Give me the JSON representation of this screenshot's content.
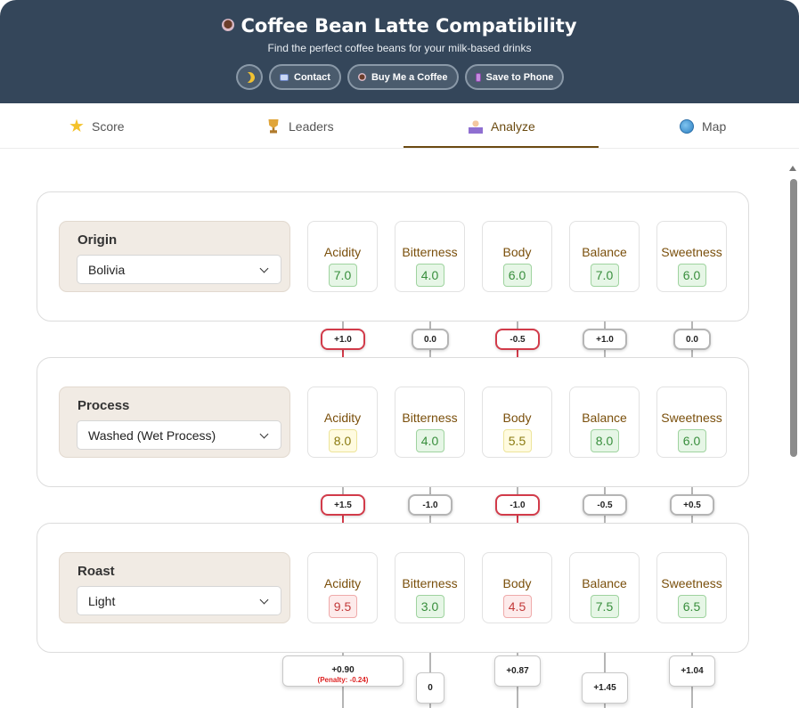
{
  "header": {
    "title": "Coffee Bean Latte Compatibility",
    "subtitle": "Find the perfect coffee beans for your milk-based drinks",
    "buttons": {
      "contact": "Contact",
      "buy": "Buy Me a Coffee",
      "save": "Save to Phone"
    },
    "icons": [
      "coffee-cup-icon",
      "moon-icon",
      "id-card-icon",
      "coffee-cup-icon",
      "phone-icon"
    ]
  },
  "tabs": [
    {
      "label": "Score",
      "icon": "star-icon",
      "active": false
    },
    {
      "label": "Leaders",
      "icon": "trophy-icon",
      "active": false
    },
    {
      "label": "Analyze",
      "icon": "scientist-icon",
      "active": true
    },
    {
      "label": "Map",
      "icon": "globe-icon",
      "active": false
    }
  ],
  "attributes": [
    "Acidity",
    "Bitterness",
    "Body",
    "Balance",
    "Sweetness"
  ],
  "sections": [
    {
      "label": "Origin",
      "selected": "Bolivia",
      "values": [
        "7.0",
        "4.0",
        "6.0",
        "7.0",
        "6.0"
      ],
      "levels": [
        "green",
        "green",
        "green",
        "green",
        "green"
      ]
    },
    {
      "label": "Process",
      "selected": "Washed (Wet Process)",
      "values": [
        "8.0",
        "4.0",
        "5.5",
        "8.0",
        "6.0"
      ],
      "levels": [
        "yellow",
        "green",
        "yellow",
        "green",
        "green"
      ]
    },
    {
      "label": "Roast",
      "selected": "Light",
      "values": [
        "9.5",
        "3.0",
        "4.5",
        "7.5",
        "6.5"
      ],
      "levels": [
        "red",
        "green",
        "red",
        "green",
        "green"
      ]
    }
  ],
  "deltas": [
    [
      "+1.0",
      "0.0",
      "-0.5",
      "+1.0",
      "0.0"
    ],
    [
      "+1.5",
      "-1.0",
      "-1.0",
      "-0.5",
      "+0.5"
    ]
  ],
  "results": {
    "acidity": "+0.90",
    "acidity_penalty": "(Penalty: -0.24)",
    "bitterness": "0",
    "body": "+0.87",
    "balance": "+1.45",
    "sweetness": "+1.04"
  },
  "colors": {
    "header_bg": "#34465a",
    "accent": "#6b4a12",
    "warn": "#d23b4a",
    "good": "#388e3c"
  }
}
